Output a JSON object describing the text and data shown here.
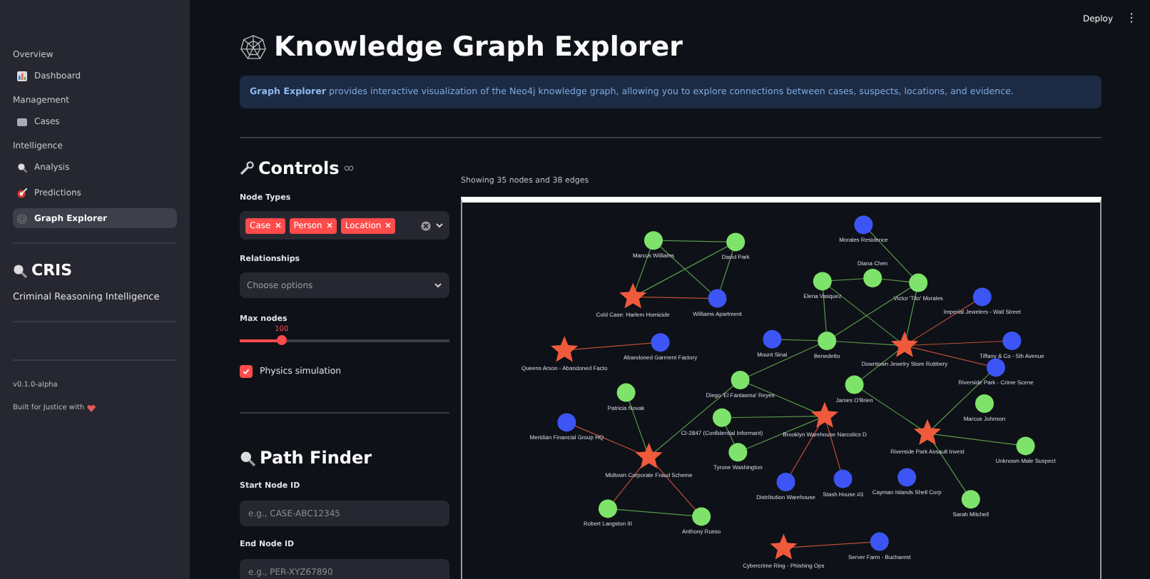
{
  "header": {
    "deploy": "Deploy",
    "menu": "⋮"
  },
  "sidebar": {
    "sections": [
      {
        "title": "Overview",
        "items": [
          {
            "label": "Dashboard",
            "selected": false
          }
        ]
      },
      {
        "title": "Management",
        "items": [
          {
            "label": "Cases",
            "selected": false
          }
        ]
      },
      {
        "title": "Intelligence",
        "items": [
          {
            "label": "Analysis",
            "selected": false
          },
          {
            "label": "Predictions",
            "selected": false
          },
          {
            "label": "Graph Explorer",
            "selected": true
          }
        ]
      }
    ],
    "brand": {
      "title": "CRIS",
      "subtitle": "Criminal Reasoning Intelligence"
    },
    "version": "v0.1.0-alpha",
    "built": "Built for Justice with"
  },
  "page": {
    "title": "Knowledge Graph Explorer",
    "info": "**Graph Explorer** provides interactive visualization of the Neo4j knowledge graph, allowing you to explore connections between cases, suspects, locations, and evidence."
  },
  "controls": {
    "title": "Controls",
    "node_types": {
      "label": "Node Types",
      "tags": [
        "Case",
        "Person",
        "Location"
      ]
    },
    "relationships": {
      "label": "Relationships",
      "placeholder": "Choose options"
    },
    "max_nodes": {
      "label": "Max nodes",
      "reading": "100",
      "level": 0.2
    },
    "physics": {
      "label": "Physics simulation",
      "checked": true
    }
  },
  "path_finder": {
    "title": "Path Finder",
    "start": {
      "label": "Start Node ID",
      "placeholder": "e.g., CASE-ABC12345"
    },
    "end": {
      "label": "End Node ID",
      "placeholder": "e.g., PER-XYZ67890"
    }
  },
  "graph": {
    "summary": "Showing 35 nodes and 38 edges",
    "nodes": [
      {
        "label": "Marcus Williams",
        "kind": "person"
      },
      {
        "label": "David Park",
        "kind": "person"
      },
      {
        "label": "Cold Case: Harlem Homicide",
        "kind": "case"
      },
      {
        "label": "Williams Apartment",
        "kind": "location"
      },
      {
        "label": "Queens Arson - Abandoned Facto",
        "kind": "case"
      },
      {
        "label": "Abandoned Garment Factory",
        "kind": "location"
      },
      {
        "label": "Mount Sinai",
        "kind": "location"
      },
      {
        "label": "Diego 'El Fantasma' Reyes",
        "kind": "person"
      },
      {
        "label": "Patricia Novak",
        "kind": "person"
      },
      {
        "label": "Meridian Financial Group HQ",
        "kind": "location"
      },
      {
        "label": "CI-2847 (Confidential Informant)",
        "kind": "person"
      },
      {
        "label": "Tyrone Washington",
        "kind": "person"
      },
      {
        "label": "Midtown Corporate Fraud Scheme",
        "kind": "case"
      },
      {
        "label": "Robert Langston III",
        "kind": "person"
      },
      {
        "label": "Anthony Russo",
        "kind": "person"
      },
      {
        "label": "Distribution Warehouse",
        "kind": "location"
      },
      {
        "label": "Cybercrime Ring - Phishing Ops",
        "kind": "case"
      },
      {
        "label": "Morales Residence",
        "kind": "location"
      },
      {
        "label": "Elena Vasquez",
        "kind": "person"
      },
      {
        "label": "Diana Chen",
        "kind": "person"
      },
      {
        "label": "Victor 'Tito' Morales",
        "kind": "person"
      },
      {
        "label": "Imperial Jewelers - Wall Street",
        "kind": "location"
      },
      {
        "label": "Benedetto",
        "kind": "person"
      },
      {
        "label": "Downtown Jewelry Store Robbery",
        "kind": "case"
      },
      {
        "label": "Tiffany & Co - 5th Avenue",
        "kind": "location"
      },
      {
        "label": "Riverside Park - Crime Scene",
        "kind": "location"
      },
      {
        "label": "James O'Brien",
        "kind": "person"
      },
      {
        "label": "Marcus Johnson",
        "kind": "person"
      },
      {
        "label": "Brooklyn Warehouse Narcotics D",
        "kind": "case"
      },
      {
        "label": "Riverside Park Assault Invest",
        "kind": "case"
      },
      {
        "label": "Unknown Male Suspect",
        "kind": "person"
      },
      {
        "label": "Stash House #3",
        "kind": "location"
      },
      {
        "label": "Cayman Islands Shell Corp",
        "kind": "location"
      },
      {
        "label": "Sarah Mitchell",
        "kind": "person"
      },
      {
        "label": "Server Farm - Bucharest",
        "kind": "location"
      }
    ]
  }
}
